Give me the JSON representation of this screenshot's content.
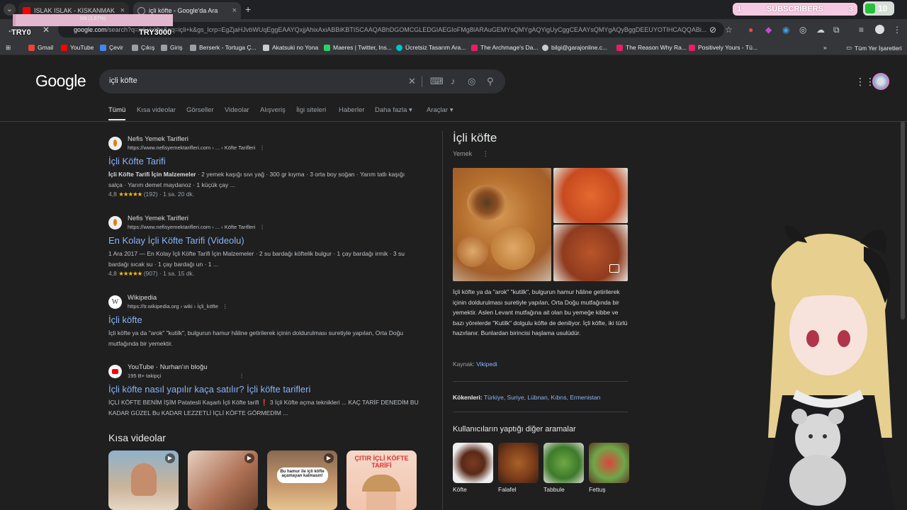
{
  "browser": {
    "tabs": [
      {
        "title": "ISLAK ISLAK - KISKANMAK DE...",
        "close": "×"
      },
      {
        "title": "içli köfte - Google'da Ara",
        "close": "×"
      }
    ],
    "new_tab": "+",
    "url_host": "google.com",
    "url_rest": "/search?q=içli+köfte&oq=içli+k&gs_lcrp=EgZjaHJvbWUqEggEAAYQxjjAhixAxiABBiKBTISCAAQABhDGOMCGLEDGIAEGIoFMg8IARAuGEMYsQMYgAQYigUyCggCEAAYsQMYgAQyBggDEEUYOTIHCAQQABi...",
    "bookmarks": [
      {
        "label": "Gmail",
        "color": "#ea4335"
      },
      {
        "label": "YouTube",
        "color": "#ff0000"
      },
      {
        "label": "Çevir",
        "color": "#4285f4"
      },
      {
        "label": "Çıkış",
        "color": "#9aa0a6"
      },
      {
        "label": "Giriş",
        "color": "#9aa0a6"
      },
      {
        "label": "Berserk - Tortuga Ç...",
        "color": "#9aa0a6"
      },
      {
        "label": "Akatsuki no Yona",
        "color": "#cccccc"
      },
      {
        "label": "Maeres | Twitter, Ins...",
        "color": "#25d366"
      },
      {
        "label": "Ücretsiz Tasarım Ara...",
        "color": "#00c4cc"
      },
      {
        "label": "The Archmage's Da...",
        "color": "#e91e63"
      },
      {
        "label": "bilgi@garajonline.c...",
        "color": "#cccccc"
      },
      {
        "label": "The Reason Why Ra...",
        "color": "#e91e63"
      },
      {
        "label": "Positively Yours - Tü...",
        "color": "#e91e63"
      }
    ],
    "bookmarks_more": "»",
    "all_bookmarks": "Tüm Yer İşaretleri"
  },
  "overlay": {
    "try0": "TRY0",
    "try3000": "TRY3000",
    "progress_text": "50t (1.67%)",
    "progress_fraction": 0.0167,
    "subs_left": "1",
    "subs_label": "SUBSCRIBERS",
    "subs_right": "3",
    "count": "10"
  },
  "google": {
    "logo": "Google",
    "query": "içli köfte",
    "filters": [
      "Tümü",
      "Kısa videolar",
      "Görseller",
      "Videolar",
      "Alışveriş",
      "İlgi siteleri",
      "Haberler",
      "Daha fazla ▾",
      "Araçlar ▾"
    ],
    "results": [
      {
        "site": "Nefis Yemek Tarifleri",
        "url": "https://www.nefisyemektarifleri.com › ... › Köfte Tarifleri",
        "title": "İçli Köfte Tarifi",
        "snippet_bold": "İçli Köfte Tarifi İçin Malzemeler",
        "snippet": " · 2 yemek kaşığı sıvı yağ · 300 gr kıyma · 3 orta boy soğan · Yarım tatlı kaşığı salça · Yarım demet maydanoz · 1 küçük çay ...",
        "rating": "4,8",
        "stars": "★★★★★",
        "reviews": "(192)",
        "time": "· 1 sa. 20 dk."
      },
      {
        "site": "Nefis Yemek Tarifleri",
        "url": "https://www.nefisyemektarifleri.com › ... › Köfte Tarifleri",
        "title": "En Kolay İçli Köfte Tarifi (Videolu)",
        "snippet": "1 Ara 2017 — En Kolay İçli Köfte Tarifi İçin Malzemeler · 2 su bardağı köftelik bulgur · 1 çay bardağı irmik · 3 su bardağı sıcak su · 1 çay bardağı un · 1 ...",
        "rating": "4,8",
        "stars": "★★★★★",
        "reviews": "(907)",
        "time": "· 1 sa. 15 dk."
      },
      {
        "site": "Wikipedia",
        "url": "https://tr.wikipedia.org › wiki › İçli_köfte",
        "title": "İçli köfte",
        "snippet": "İçli köfte ya da \"arok\" \"kutilk\", bulgurun hamur hâline getirilerek içinin doldurulması suretiyle yapılan, Orta Doğu mutfağında bir yemektir."
      },
      {
        "site": "YouTube · Nurhan'ın bloğu",
        "url": "195 B+ takipçi",
        "title": "İçli köfte nasıl yapılır kaça satılır? İçli köfte tarifleri",
        "snippet": "İÇLİ KÖFTE BENİM İŞİM Patatesli Kaşarlı İçli Köfte tarifi ❗ 3 İçli Köfte açma teknikleri ... KAÇ TARİF DENEDİM BU KADAR GÜZEL Bu KADAR LEZZETLİ İÇLİ KÖFTE GÖRMEDİM ..."
      }
    ],
    "short_videos_title": "Kısa videolar",
    "thumbs": [
      {
        "text": ""
      },
      {
        "text": ""
      },
      {
        "text": "Bu hamur ile içli köfte açamayan kalmasın!"
      },
      {
        "text": "ÇITIR İÇLİ KÖFTE TARİFİ"
      }
    ]
  },
  "knowledge_panel": {
    "title": "İçli köfte",
    "subtitle": "Yemek",
    "description": "İçli köfte ya da \"arok\" \"kutilk\", bulgurun hamur hâline getirilerek içinin doldurulması suretiyle yapılan, Orta Doğu mutfağında bir yemektir. Aslen Levant mutfağına ait olan bu yemeğe kibbe ve bazı yörelerde \"Kutilk\" dolgulu köfte de deniliyor. İçli köfte, iki türlü hazırlanır. Bunlardan birincisi haşlama usulüdür.",
    "source_label": "Kaynak: ",
    "source_link": "Vikipedi",
    "origin_label": "Kökenleri: ",
    "origins": "Türkiye, Suriye, Lübnan, Kıbrıs, Ermenistan",
    "also_title": "Kullanıcıların yaptığı diğer aramalar",
    "also": [
      "Köfte",
      "Falafel",
      "Tabbule",
      "Fettuş"
    ]
  }
}
